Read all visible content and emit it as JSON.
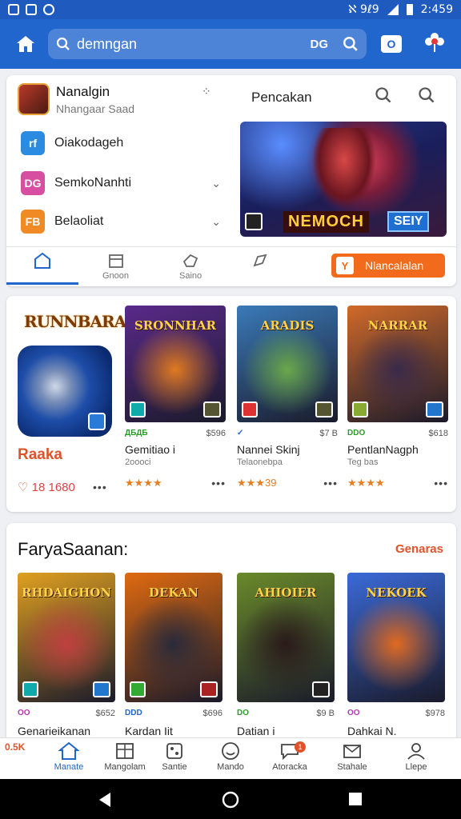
{
  "status": {
    "time": "2:459",
    "signal": "ℵ 9ℓ9"
  },
  "appbar": {
    "search_text": "demngan",
    "search_badge": "DG",
    "tv_label": "O"
  },
  "profile": {
    "name": "Nanalgin",
    "subtitle": "Nhangaar Saad"
  },
  "menu": [
    {
      "label": "Oiakodageh",
      "icon_text": "rf",
      "icon_color": "#2a8be0"
    },
    {
      "label": "SemkoNanhti",
      "icon_text": "DG",
      "icon_color": "#d64fa0"
    },
    {
      "label": "Belaoliat",
      "icon_text": "FB",
      "icon_color": "#f08a24"
    }
  ],
  "right_title": "Pencakan",
  "banner": {
    "title": "NEMOCH",
    "badge": "SEIY"
  },
  "tabs": [
    {
      "label": ""
    },
    {
      "label": "Gnoon"
    },
    {
      "label": "Saino"
    },
    {
      "label": ""
    }
  ],
  "cta_label": "Nlancalalan",
  "cta_check": "Y",
  "feature": {
    "logo": "RUNNBARA",
    "name": "Raaka",
    "count": "18 1680"
  },
  "games": [
    {
      "title": "SRONNHAR",
      "tag": "ДБДБ",
      "price": "$596",
      "name": "Gemitiao i",
      "sub": "2oooci",
      "rating": "★★★★",
      "colors": [
        "#5a2a8a",
        "#e07a20"
      ]
    },
    {
      "title": "ARADIS",
      "tag": "✓",
      "price": "$7 B",
      "name": "Nannei Skinj",
      "sub": "Telaonebpa",
      "rating": "★★★39",
      "colors": [
        "#3a7ab8",
        "#6aa84a"
      ]
    },
    {
      "title": "NARRAR",
      "tag": "DDO",
      "price": "$618",
      "name": "PentlanNagph",
      "sub": "Teg bas",
      "rating": "★★★★",
      "colors": [
        "#d06a2a",
        "#3a2a4a"
      ]
    }
  ],
  "section2": {
    "title": "FaryaSaanan:",
    "link": "Genaras",
    "games": [
      {
        "title": "RHDAIGHON",
        "tag": "OO",
        "price": "$652",
        "name": "Genarieikanan",
        "colors": [
          "#e0a020",
          "#c04040"
        ]
      },
      {
        "title": "DEKAN",
        "tag": "DDD",
        "price": "$696",
        "name": "Kardan Iit",
        "colors": [
          "#e06a10",
          "#2a2a3a"
        ]
      },
      {
        "title": "AHIOIER",
        "tag": "DO",
        "price": "$9 B",
        "name": "Datian i",
        "colors": [
          "#6a8a2a",
          "#2a1a1a"
        ]
      },
      {
        "title": "NEKOEK",
        "tag": "OO",
        "price": "$978",
        "name": "Dahkai N.",
        "colors": [
          "#3a6ad8",
          "#e06a20"
        ]
      }
    ]
  },
  "bottom_left": "0.5K",
  "bottom_nav": [
    {
      "label": "Manate",
      "icon": "home-icon",
      "active": true
    },
    {
      "label": "Mangolam",
      "icon": "grid-icon"
    },
    {
      "label": "Santie",
      "icon": "apps-icon"
    },
    {
      "label": "Mando",
      "icon": "smile-icon"
    },
    {
      "label": "Atoracka",
      "icon": "chat-icon",
      "badge": "1"
    },
    {
      "label": "Stahale",
      "icon": "mail-icon"
    },
    {
      "label": "Llepe",
      "icon": "user-icon"
    }
  ]
}
